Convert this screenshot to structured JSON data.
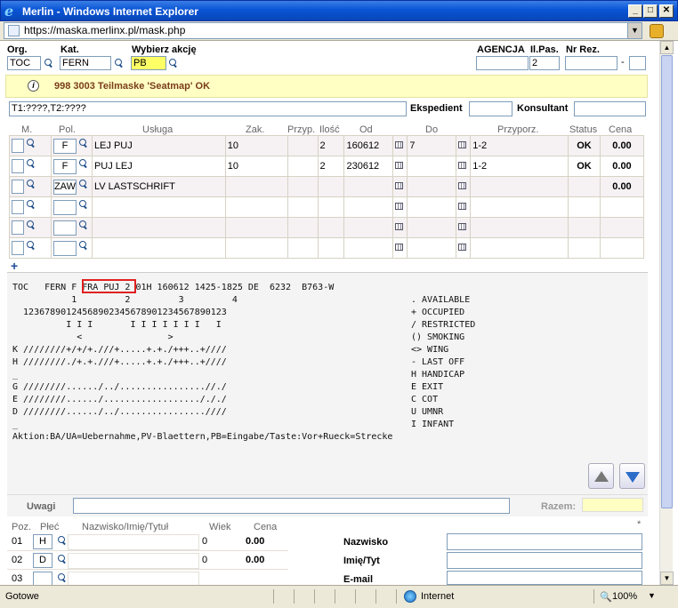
{
  "window": {
    "title": "Merlin - Windows Internet Explorer",
    "min": "_",
    "max": "□",
    "close": "✕"
  },
  "address": {
    "url": "https://maska.merlinx.pl/mask.php"
  },
  "form": {
    "org_label": "Org.",
    "org_value": "TOC",
    "kat_label": "Kat.",
    "kat_value": "FERN",
    "akcja_label": "Wybierz akcję",
    "akcja_value": "PB",
    "agencja_label": "AGENCJA",
    "ilpas_label": "Il.Pas.",
    "nrrez_label": "Nr Rez.",
    "agencja_value": "",
    "ilpas_value": "2",
    "nrrez_value": "",
    "nrrez_suffix": "-"
  },
  "message": {
    "icon": "info-icon",
    "text": "998 3003 Teilmaske 'Seatmap' OK"
  },
  "tline": {
    "value": "T1:????,T2:????",
    "ekspedient_label": "Ekspedient",
    "konsultant_label": "Konsultant"
  },
  "services": {
    "headers": [
      "M.",
      "Pol.",
      "Usługa",
      "Zak.",
      "Przyp.",
      "Ilość",
      "Od",
      "Do",
      "Przyporz.",
      "Status",
      "Cena"
    ],
    "rows": [
      {
        "pol": "F",
        "usluga": "LEJ PUJ",
        "zak": "10",
        "przyp": "",
        "ilosc": "2",
        "od": "160612",
        "do": "7",
        "przyporz": "1-2",
        "status": "OK",
        "cena": "0.00"
      },
      {
        "pol": "F",
        "usluga": "PUJ LEJ",
        "zak": "10",
        "przyp": "",
        "ilosc": "2",
        "od": "230612",
        "do": "",
        "przyporz": "1-2",
        "status": "OK",
        "cena": "0.00"
      },
      {
        "pol": "ZAW",
        "usluga": "LV LASTSCHRIFT",
        "zak": "",
        "przyp": "",
        "ilosc": "",
        "od": "",
        "do": "",
        "przyporz": "",
        "status": "",
        "cena": "0.00"
      },
      {
        "pol": "",
        "usluga": "",
        "zak": "",
        "przyp": "",
        "ilosc": "",
        "od": "",
        "do": "",
        "przyporz": "",
        "status": "",
        "cena": ""
      },
      {
        "pol": "",
        "usluga": "",
        "zak": "",
        "przyp": "",
        "ilosc": "",
        "od": "",
        "do": "",
        "przyporz": "",
        "status": "",
        "cena": ""
      },
      {
        "pol": "",
        "usluga": "",
        "zak": "",
        "przyp": "",
        "ilosc": "",
        "od": "",
        "do": "",
        "przyporz": "",
        "status": "",
        "cena": ""
      }
    ],
    "add_label": "+"
  },
  "seatmap": {
    "lines": [
      "TOC   FERN F FRA PUJ 2 01H 160612 1425-1825 DE  6232  B763-W",
      "           1         2         3         4",
      "  12367890124568902345678901234567890123",
      "          I I I       I I I I I I I   I",
      "            <                >",
      "K ////////+/+/+.///+.....+.+./+++..+////",
      "H ////////./+.+.///+.....+.+./+++..+////",
      "_",
      "G ////////....../../................//./",
      "E ////////....../................../././",
      "D ////////....../../................////",
      "_",
      "Aktion:BA/UA=Uebernahme,PV-Blaettern,PB=Eingabe/Taste:Vor+Rueck=Strecke"
    ],
    "legend": [
      ". AVAILABLE",
      "+ OCCUPIED",
      "/ RESTRICTED",
      "() SMOKING",
      "<> WING",
      "- LAST OFF",
      "H HANDICAP",
      "E EXIT",
      "C COT",
      "U UMNR",
      "I INFANT"
    ]
  },
  "uwagi": {
    "label": "Uwagi",
    "value": "",
    "razem_label": "Razem:",
    "razem_value": ""
  },
  "passengers": {
    "headers": [
      "Poz.",
      "Płeć",
      "Nazwisko/Imię/Tytuł",
      "Wiek",
      "Cena"
    ],
    "asterisk": "*",
    "rows": [
      {
        "poz": "01",
        "plec": "H",
        "nazwisko": "",
        "wiek": "0",
        "cena": "0.00"
      },
      {
        "poz": "02",
        "plec": "D",
        "nazwisko": "",
        "wiek": "0",
        "cena": "0.00"
      },
      {
        "poz": "03",
        "plec": "",
        "nazwisko": "",
        "wiek": "",
        "cena": ""
      }
    ],
    "side_labels": [
      "Nazwisko",
      "Imię/Tyt",
      "E-mail"
    ]
  },
  "status": {
    "text": "Gotowe",
    "zone": "Internet",
    "zoom": "100%"
  }
}
